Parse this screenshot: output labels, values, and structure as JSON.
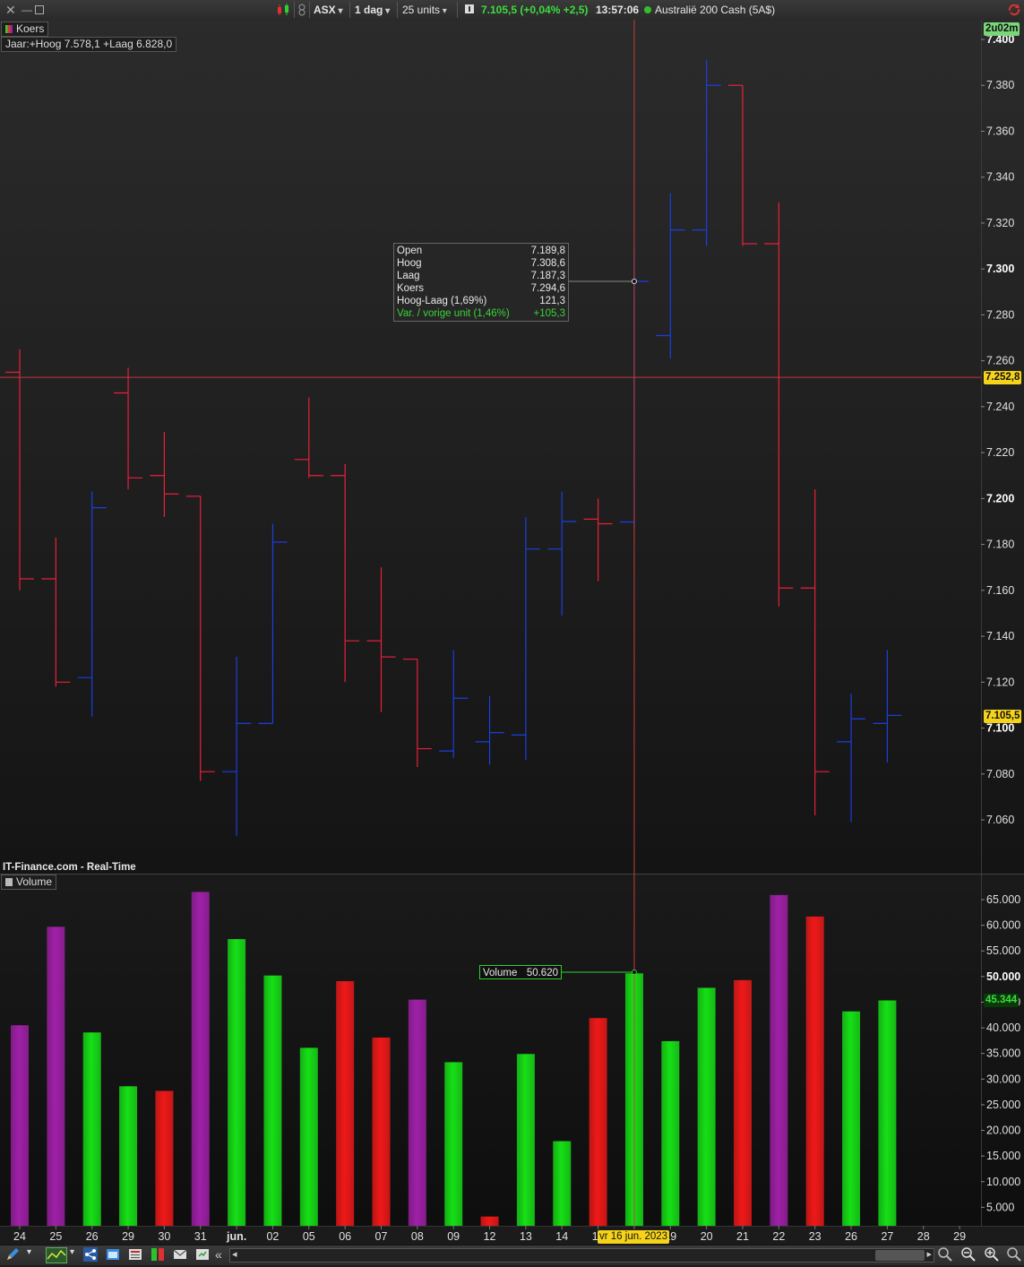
{
  "toolbar": {
    "exchange": "ASX",
    "interval": "1 dag",
    "units": "25 units",
    "quote": "7.105,5 (+0,04% +2,5)",
    "time": "13:57:06",
    "instrument": "Australië 200 Cash (5A$)",
    "icons": [
      "close-icon",
      "minimize-icon",
      "maximize-icon",
      "candlestick-chart-icon",
      "link-icon",
      "info-icon",
      "market-open-dot-icon",
      "refresh-icon"
    ]
  },
  "price_panel": {
    "label": "Koers",
    "range_info": "Jaar:+Hoog 7.578,1 +Laag 6.828,0",
    "timer": "2u02m",
    "watermark": "IT-Finance.com - Real-Time",
    "last_price_tag": "7.105,5",
    "crosshair_price_tag": "7.252,8",
    "colors": {
      "up": "#1a3fe0",
      "down": "#e8203a",
      "crosshair": "#c83a3a",
      "last_price_bg": "#f5d31a",
      "timer_bg": "#7ad67a"
    }
  },
  "tooltip": {
    "rows": [
      {
        "label": "Open",
        "value": "7.189,8"
      },
      {
        "label": "Hoog",
        "value": "7.308,6"
      },
      {
        "label": "Laag",
        "value": "7.187,3"
      },
      {
        "label": "Koers",
        "value": "7.294,6"
      },
      {
        "label": "Hoog-Laag (1,69%)",
        "value": "121,3"
      },
      {
        "label": "Var. / vorige unit (1,46%)",
        "value": "+105,3"
      }
    ]
  },
  "volume_panel": {
    "label": "Volume",
    "tip_label": "Volume",
    "tip_value": "50.620",
    "last_volume_tag": "45.344"
  },
  "date_tag": "vr 16 jun. 2023",
  "chart_data": [
    {
      "type": "ohlc",
      "title": "Koers",
      "ylim": [
        7050,
        7405
      ],
      "y_ticks": [
        {
          "v": 7060,
          "label": "7.060"
        },
        {
          "v": 7080,
          "label": "7.080"
        },
        {
          "v": 7100,
          "label": "7.100"
        },
        {
          "v": 7120,
          "label": "7.120"
        },
        {
          "v": 7140,
          "label": "7.140"
        },
        {
          "v": 7160,
          "label": "7.160"
        },
        {
          "v": 7180,
          "label": "7.180"
        },
        {
          "v": 7200,
          "label": "7.200"
        },
        {
          "v": 7220,
          "label": "7.220"
        },
        {
          "v": 7240,
          "label": "7.240"
        },
        {
          "v": 7260,
          "label": "7.260"
        },
        {
          "v": 7280,
          "label": "7.280"
        },
        {
          "v": 7300,
          "label": "7.300"
        },
        {
          "v": 7320,
          "label": "7.320"
        },
        {
          "v": 7340,
          "label": "7.340"
        },
        {
          "v": 7360,
          "label": "7.360"
        },
        {
          "v": 7380,
          "label": "7.380"
        },
        {
          "v": 7400,
          "label": "7.400"
        }
      ],
      "bold_ticks": [
        7100,
        7200,
        7300,
        7400
      ],
      "categories": [
        "24",
        "25",
        "26",
        "29",
        "30",
        "31",
        "jun.",
        "02",
        "05",
        "06",
        "07",
        "08",
        "09",
        "12",
        "13",
        "14",
        "15",
        "16",
        "19",
        "20",
        "21",
        "22",
        "23",
        "26",
        "27",
        "28",
        "29"
      ],
      "bars": [
        {
          "o": 7255,
          "h": 7265,
          "l": 7160,
          "c": 7165
        },
        {
          "o": 7165,
          "h": 7183,
          "l": 7118,
          "c": 7120
        },
        {
          "o": 7122,
          "h": 7203,
          "l": 7105,
          "c": 7196
        },
        {
          "o": 7246,
          "h": 7257,
          "l": 7204,
          "c": 7209
        },
        {
          "o": 7210,
          "h": 7229,
          "l": 7192,
          "c": 7202
        },
        {
          "o": 7201,
          "h": 7201,
          "l": 7077,
          "c": 7081
        },
        {
          "o": 7081,
          "h": 7131,
          "l": 7053,
          "c": 7102
        },
        {
          "o": 7102,
          "h": 7189,
          "l": 7102,
          "c": 7181
        },
        {
          "o": 7217,
          "h": 7244,
          "l": 7209,
          "c": 7210
        },
        {
          "o": 7210,
          "h": 7215,
          "l": 7120,
          "c": 7138
        },
        {
          "o": 7138,
          "h": 7170,
          "l": 7107,
          "c": 7131
        },
        {
          "o": 7130,
          "h": 7130,
          "l": 7083,
          "c": 7091
        },
        {
          "o": 7090,
          "h": 7134,
          "l": 7087,
          "c": 7113
        },
        {
          "o": 7094,
          "h": 7114,
          "l": 7084,
          "c": 7098
        },
        {
          "o": 7097,
          "h": 7192,
          "l": 7086,
          "c": 7178
        },
        {
          "o": 7178,
          "h": 7203,
          "l": 7149,
          "c": 7190
        },
        {
          "o": 7191,
          "h": 7200,
          "l": 7164,
          "c": 7189
        },
        {
          "o": 7189.8,
          "h": 7308.6,
          "l": 7187.3,
          "c": 7294.6
        },
        {
          "o": 7271,
          "h": 7333,
          "l": 7261,
          "c": 7317
        },
        {
          "o": 7317,
          "h": 7391,
          "l": 7310,
          "c": 7380
        },
        {
          "o": 7380,
          "h": 7380,
          "l": 7310,
          "c": 7311
        },
        {
          "o": 7311,
          "h": 7329,
          "l": 7153,
          "c": 7161
        },
        {
          "o": 7161,
          "h": 7204,
          "l": 7062,
          "c": 7081
        },
        {
          "o": 7094,
          "h": 7115,
          "l": 7059,
          "c": 7104
        },
        {
          "o": 7102,
          "h": 7134,
          "l": 7085,
          "c": 7105.5
        }
      ]
    },
    {
      "type": "bar",
      "title": "Volume",
      "ylim": [
        0,
        67000
      ],
      "y_ticks": [
        {
          "v": 5000,
          "label": "5.000"
        },
        {
          "v": 10000,
          "label": "10.000"
        },
        {
          "v": 15000,
          "label": "15.000"
        },
        {
          "v": 20000,
          "label": "20.000"
        },
        {
          "v": 25000,
          "label": "25.000"
        },
        {
          "v": 30000,
          "label": "30.000"
        },
        {
          "v": 35000,
          "label": "35.000"
        },
        {
          "v": 40000,
          "label": "40.000"
        },
        {
          "v": 45000,
          "label": "45.000"
        },
        {
          "v": 50000,
          "label": "50.000"
        },
        {
          "v": 55000,
          "label": "55.000"
        },
        {
          "v": 60000,
          "label": "60.000"
        },
        {
          "v": 65000,
          "label": "65.000"
        }
      ],
      "bold_ticks": [
        50000
      ],
      "series": [
        {
          "values": [
            40500,
            59700,
            39100,
            28600,
            27700,
            66500,
            57300,
            50200,
            36100,
            49100,
            38100,
            45500,
            33300,
            3200,
            34900,
            17900,
            41900,
            50620,
            37400,
            47800,
            49300,
            65900,
            61700,
            43200,
            45344
          ],
          "colors": [
            "purple",
            "purple",
            "green",
            "green",
            "red",
            "purple",
            "green",
            "green",
            "green",
            "red",
            "red",
            "purple",
            "green",
            "red",
            "green",
            "green",
            "red",
            "green",
            "green",
            "green",
            "red",
            "purple",
            "red",
            "green",
            "green"
          ]
        }
      ],
      "palette": {
        "green": "#16e016",
        "red": "#f01818",
        "purple": "#a020a8"
      }
    }
  ]
}
